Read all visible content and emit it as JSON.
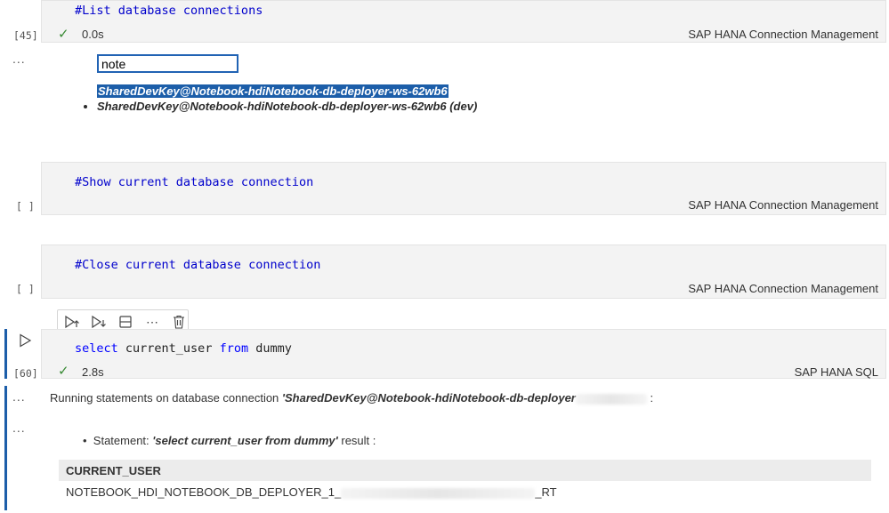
{
  "cells": [
    {
      "code": "#List database connections",
      "exec_count": "[45]",
      "duration": "0.0s",
      "kernel": "SAP HANA Connection Management"
    },
    {
      "code": "#Show current database connection",
      "exec_count": "[ ]",
      "kernel": "SAP HANA Connection Management"
    },
    {
      "code": "#Close current database connection",
      "exec_count": "[ ]",
      "kernel": "SAP HANA Connection Management"
    },
    {
      "code_parts": [
        "select",
        " current_user ",
        "from",
        " dummy"
      ],
      "exec_count": "[60]",
      "duration": "2.8s",
      "kernel": "SAP HANA SQL"
    }
  ],
  "output1": {
    "ellipsis": "...",
    "input_value": "note",
    "selected_item": "SharedDevKey@Notebook-hdiNotebook-db-deployer-ws-62wb6",
    "list_item": "SharedDevKey@Notebook-hdiNotebook-db-deployer-ws-62wb6 (dev)"
  },
  "toolbar": {
    "more": "⋯"
  },
  "output4": {
    "ellipsis1": "...",
    "ellipsis2": "...",
    "running_prefix": "Running statements on database connection ",
    "running_conn": "'SharedDevKey@Notebook-hdiNotebook-db-deployer",
    "running_suffix": " :",
    "statement_label": "Statement: ",
    "statement_value": "'select current_user from dummy'",
    "statement_suffix": " result :",
    "table_header": "CURRENT_USER",
    "table_value_prefix": "NOTEBOOK_HDI_NOTEBOOK_DB_DEPLOYER_1_",
    "table_value_suffix": "_RT"
  },
  "icons": [
    "check-icon",
    "run-cell-icon",
    "execute-above-icon",
    "execute-below-icon",
    "split-cell-icon",
    "more-icon",
    "delete-icon"
  ]
}
